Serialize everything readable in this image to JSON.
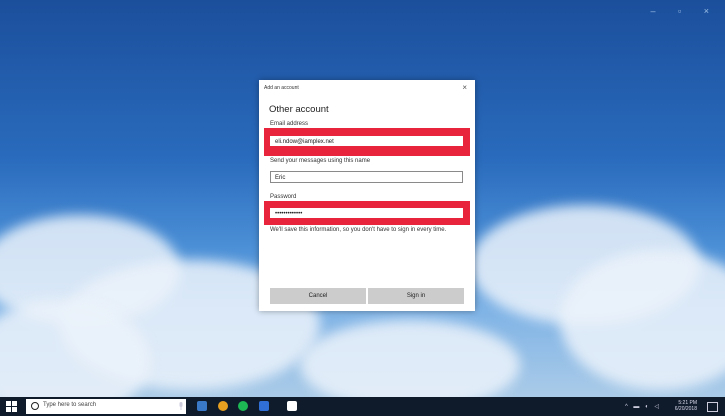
{
  "dialog": {
    "title": "Add an account",
    "heading": "Other account",
    "email_label": "Email address",
    "email_value": "eli.ndow@iamplex.net",
    "name_label": "Send your messages using this name",
    "name_value": "Eric",
    "password_label": "Password",
    "password_value": "•••••••••••••",
    "note": "We'll save this information, so you don't have to sign in every time.",
    "cancel_label": "Cancel",
    "signin_label": "Sign in",
    "close_glyph": "×"
  },
  "taskbar": {
    "search_placeholder": "Type here to search",
    "time": "5:21 PM",
    "date": "6/20/2018"
  },
  "window_controls": "–  ▫  ×",
  "colors": {
    "redaction": "#e8243c",
    "taskbar": "#0f1b2b"
  }
}
